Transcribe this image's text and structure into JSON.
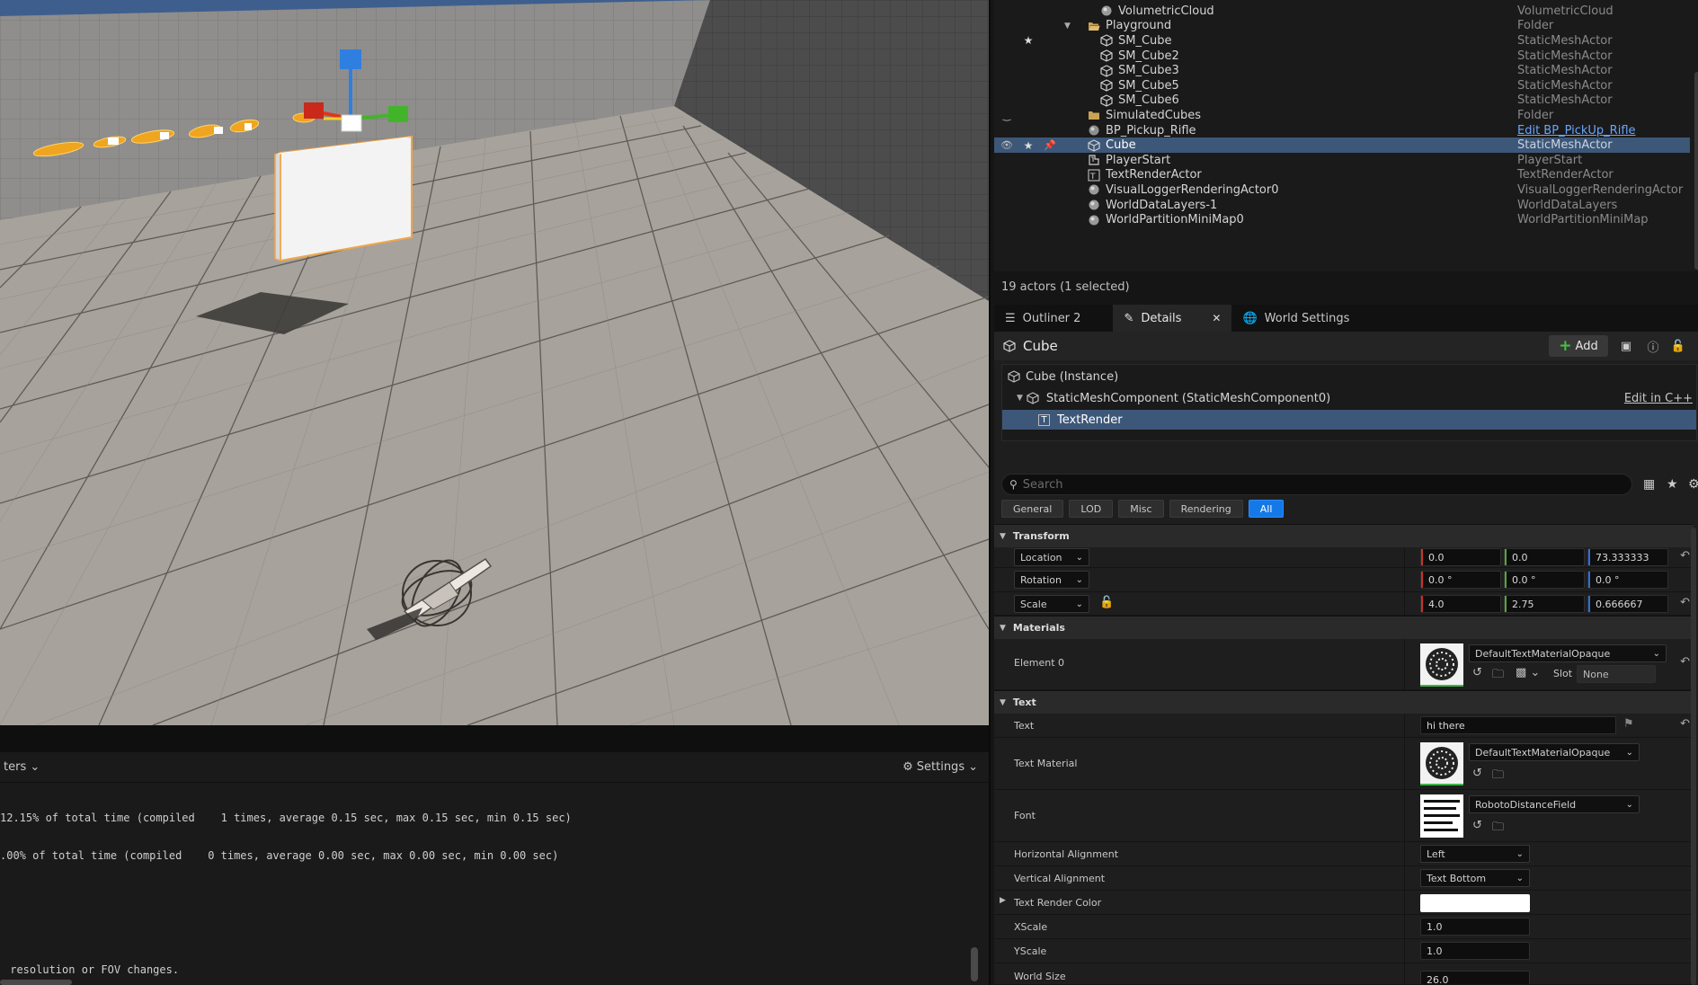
{
  "outliner": {
    "rows": [
      {
        "name": "VolumetricCloud",
        "type": "VolumetricCloud",
        "indent": 2,
        "icon": "sphere-actor-icon"
      },
      {
        "name": "Playground",
        "type": "Folder",
        "indent": 1,
        "icon": "folder-open-icon",
        "expanded": true
      },
      {
        "name": "SM_Cube",
        "type": "StaticMeshActor",
        "indent": 2,
        "icon": "static-mesh-icon",
        "star": true
      },
      {
        "name": "SM_Cube2",
        "type": "StaticMeshActor",
        "indent": 2,
        "icon": "static-mesh-icon"
      },
      {
        "name": "SM_Cube3",
        "type": "StaticMeshActor",
        "indent": 2,
        "icon": "static-mesh-icon"
      },
      {
        "name": "SM_Cube5",
        "type": "StaticMeshActor",
        "indent": 2,
        "icon": "static-mesh-icon"
      },
      {
        "name": "SM_Cube6",
        "type": "StaticMeshActor",
        "indent": 2,
        "icon": "static-mesh-icon"
      },
      {
        "name": "SimulatedCubes",
        "type": "Folder",
        "indent": 1,
        "icon": "folder-icon",
        "hidden_eye": true
      },
      {
        "name": "BP_Pickup_Rifle",
        "type": "Edit BP_PickUp_Rifle",
        "indent": 1,
        "icon": "blueprint-actor-icon",
        "type_link": true
      },
      {
        "name": "Cube",
        "type": "StaticMeshActor",
        "indent": 1,
        "icon": "static-mesh-icon",
        "selected": true
      },
      {
        "name": "PlayerStart",
        "type": "PlayerStart",
        "indent": 1,
        "icon": "player-start-icon"
      },
      {
        "name": "TextRenderActor",
        "type": "TextRenderActor",
        "indent": 1,
        "icon": "text-render-icon"
      },
      {
        "name": "VisualLoggerRenderingActor0",
        "type": "VisualLoggerRenderingActor",
        "indent": 1,
        "icon": "sphere-actor-icon"
      },
      {
        "name": "WorldDataLayers-1",
        "type": "WorldDataLayers",
        "indent": 1,
        "icon": "sphere-actor-icon"
      },
      {
        "name": "WorldPartitionMiniMap0",
        "type": "WorldPartitionMiniMap",
        "indent": 1,
        "icon": "sphere-actor-icon"
      }
    ],
    "status": "19 actors (1 selected)"
  },
  "tabs": [
    {
      "label": "Outliner 2",
      "icon": "outliner-icon"
    },
    {
      "label": "Details",
      "icon": "details-pencil-icon",
      "active": true
    },
    {
      "label": "World Settings",
      "icon": "globe-icon"
    }
  ],
  "details": {
    "title": "Cube",
    "add_label": "Add",
    "components": [
      {
        "label": "Cube (Instance)",
        "indent": 0
      },
      {
        "label": "StaticMeshComponent (StaticMeshComponent0)",
        "indent": 1,
        "edit": "Edit in C++"
      },
      {
        "label": "TextRender",
        "indent": 2,
        "selected": true
      }
    ],
    "search_placeholder": "Search",
    "filters": [
      "General",
      "LOD",
      "Misc",
      "Rendering",
      "All"
    ],
    "active_filter": "All",
    "sections": {
      "transform": "Transform",
      "materials": "Materials",
      "text": "Text"
    },
    "transform": {
      "location_label": "Location",
      "rotation_label": "Rotation",
      "scale_label": "Scale",
      "location": [
        "0.0",
        "0.0",
        "73.333333"
      ],
      "rotation": [
        "0.0 °",
        "0.0 °",
        "0.0 °"
      ],
      "scale": [
        "4.0",
        "2.75",
        "0.666667"
      ]
    },
    "materials": {
      "element_label": "Element 0",
      "material": "DefaultTextMaterialOpaque",
      "slot_label": "Slot",
      "slot_value": "None"
    },
    "text": {
      "text_label": "Text",
      "text_value": "hi there",
      "text_material_label": "Text Material",
      "text_material_value": "DefaultTextMaterialOpaque",
      "font_label": "Font",
      "font_value": "RobotoDistanceField",
      "h_align_label": "Horizontal Alignment",
      "h_align_value": "Left",
      "v_align_label": "Vertical Alignment",
      "v_align_value": "Text Bottom",
      "color_label": "Text Render Color",
      "color_value": "#FFFFFF",
      "xscale_label": "XScale",
      "xscale_value": "1.0",
      "yscale_label": "YScale",
      "yscale_value": "1.0",
      "world_size_label": "World Size",
      "world_size_value": "26.0"
    }
  },
  "log": {
    "filters_label": "ters",
    "settings_label": "Settings",
    "lines": [
      "12.15% of total time (compiled    1 times, average 0.15 sec, max 0.15 sec, min 0.15 sec)",
      ".00% of total time (compiled    0 times, average 0.00 sec, max 0.00 sec, min 0.00 sec)"
    ],
    "bottom_line": " resolution or FOV changes."
  },
  "colors": {
    "selection": "#3d5778",
    "accent_blue": "#1479e6",
    "add_green": "#42c342"
  }
}
